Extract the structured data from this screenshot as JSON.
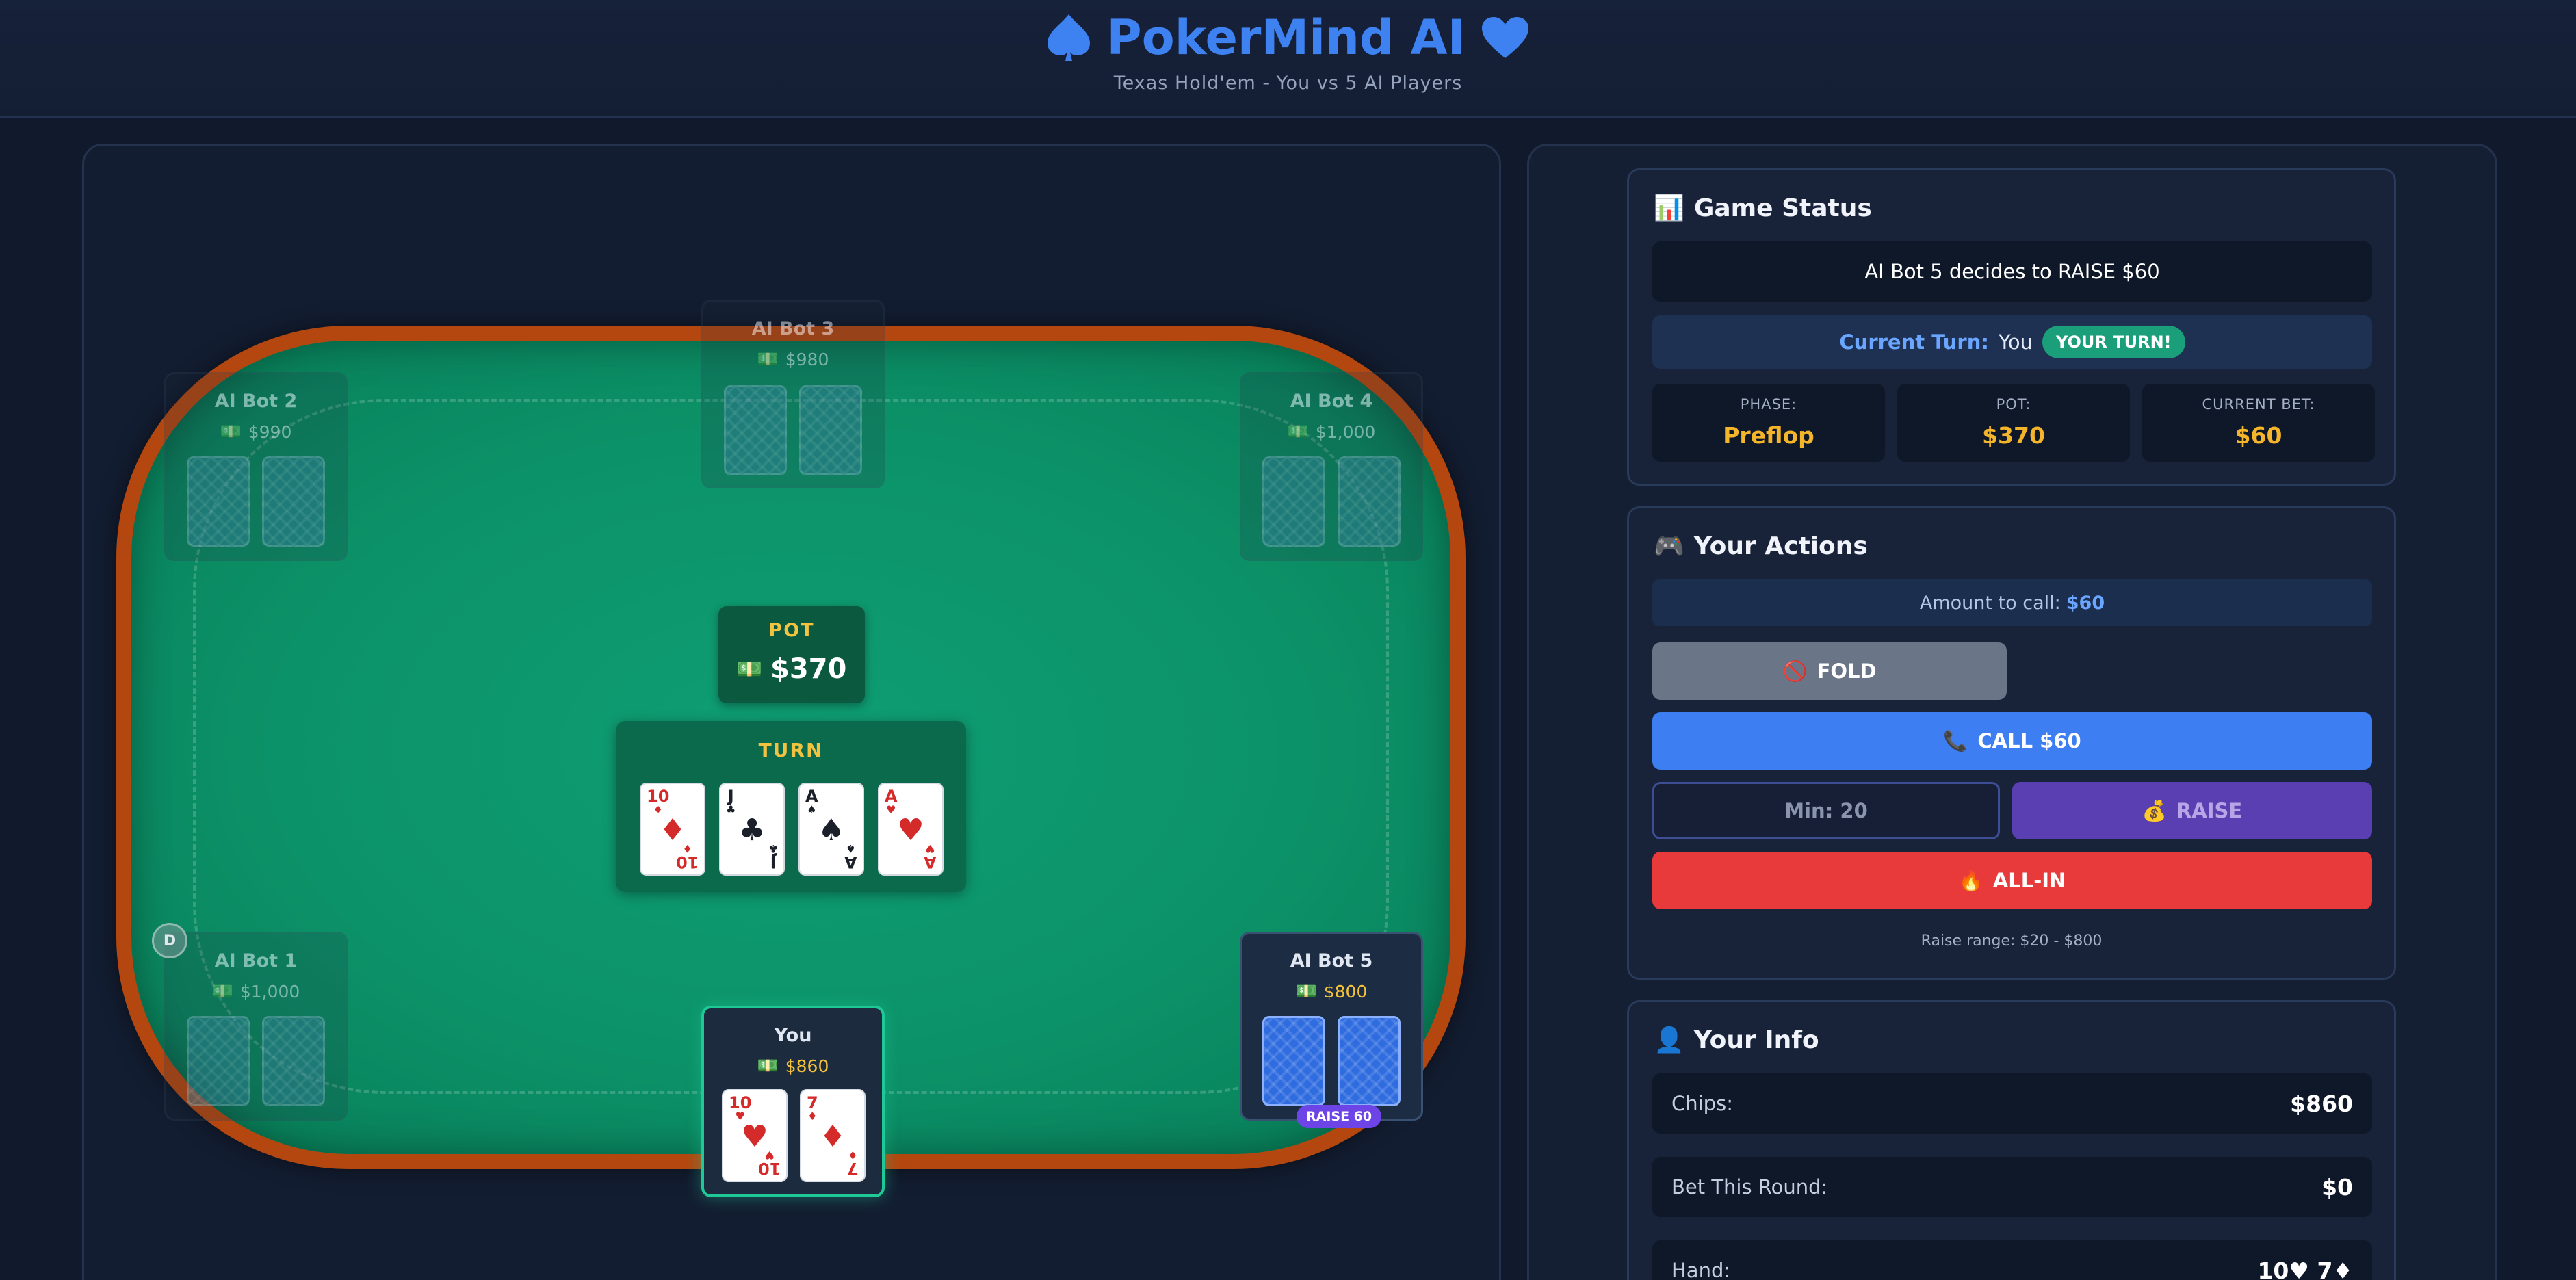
{
  "header": {
    "title": "PokerMind AI",
    "subtitle": "Texas Hold'em - You vs 5 AI Players"
  },
  "colors": {
    "accent_blue": "#3d82f0",
    "felt_green": "#0c9268",
    "table_rim": "#b4470f",
    "gold": "#f4b52a",
    "fold_gray": "#6a7588",
    "call_blue": "#3d7ef2",
    "raise_purple": "#5a3fb3",
    "allin_red": "#e83a3a",
    "you_border": "#1fc897"
  },
  "seats": {
    "bot1": {
      "name": "AI Bot 1",
      "chips": "$1,000"
    },
    "bot2": {
      "name": "AI Bot 2",
      "chips": "$990"
    },
    "bot3": {
      "name": "AI Bot 3",
      "chips": "$980"
    },
    "bot4": {
      "name": "AI Bot 4",
      "chips": "$1,000"
    },
    "bot5": {
      "name": "AI Bot 5",
      "chips": "$800",
      "action_badge": "RAISE 60"
    },
    "you": {
      "name": "You",
      "chips": "$860",
      "cards": [
        {
          "rank": "10",
          "suit": "♥",
          "color": "red"
        },
        {
          "rank": "7",
          "suit": "♦",
          "color": "red"
        }
      ]
    }
  },
  "dealer_button": "D",
  "pot": {
    "label": "POT",
    "amount": "$370"
  },
  "board": {
    "label": "TURN",
    "cards": [
      {
        "rank": "10",
        "suit": "♦",
        "color": "red"
      },
      {
        "rank": "J",
        "suit": "♣",
        "color": "black"
      },
      {
        "rank": "A",
        "suit": "♠",
        "color": "black"
      },
      {
        "rank": "A",
        "suit": "♥",
        "color": "red"
      }
    ]
  },
  "game_status": {
    "title": "Game Status",
    "message": "AI Bot 5 decides to RAISE $60",
    "current_turn_label": "Current Turn:",
    "current_turn_value": "You",
    "turn_badge": "YOUR TURN!",
    "phase_label": "PHASE:",
    "phase_value": "Preflop",
    "pot_label": "POT:",
    "pot_value": "$370",
    "bet_label": "CURRENT BET:",
    "bet_value": "$60"
  },
  "actions": {
    "title": "Your Actions",
    "call_info_label": "Amount to call:",
    "call_info_value": "$60",
    "fold": "FOLD",
    "call": "CALL $60",
    "raise_placeholder": "Min: 20",
    "raise": "RAISE",
    "allin": "ALL-IN",
    "range": "Raise range: $20 - $800"
  },
  "info": {
    "title": "Your Info",
    "chips_label": "Chips:",
    "chips_value": "$860",
    "bet_label": "Bet This Round:",
    "bet_value": "$0",
    "hand_label": "Hand:",
    "hand_value": "10♥ 7♦"
  }
}
